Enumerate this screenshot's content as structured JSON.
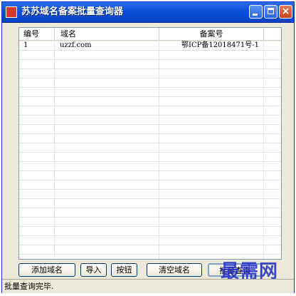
{
  "window": {
    "title": "苏苏域名备案批量查询器",
    "icon": "app-icon"
  },
  "list": {
    "columns": [
      "编号",
      "域名",
      "备案号"
    ],
    "rows": [
      {
        "id": "1",
        "domain": "uzzf.com",
        "record": "鄂ICP备12018471号-1"
      }
    ]
  },
  "toolbar": {
    "add_domain": "添加域名",
    "import": "导入",
    "button": "按钮",
    "clear_domain": "清空域名",
    "batch_query": "批量查询"
  },
  "watermark": "最需网",
  "status": {
    "text": "批量查询完毕."
  },
  "colors": {
    "titlebar": "#0a50d8",
    "window_bg": "#ece9d8",
    "close_button": "#c8431f",
    "watermark": "#1d2ac8"
  }
}
